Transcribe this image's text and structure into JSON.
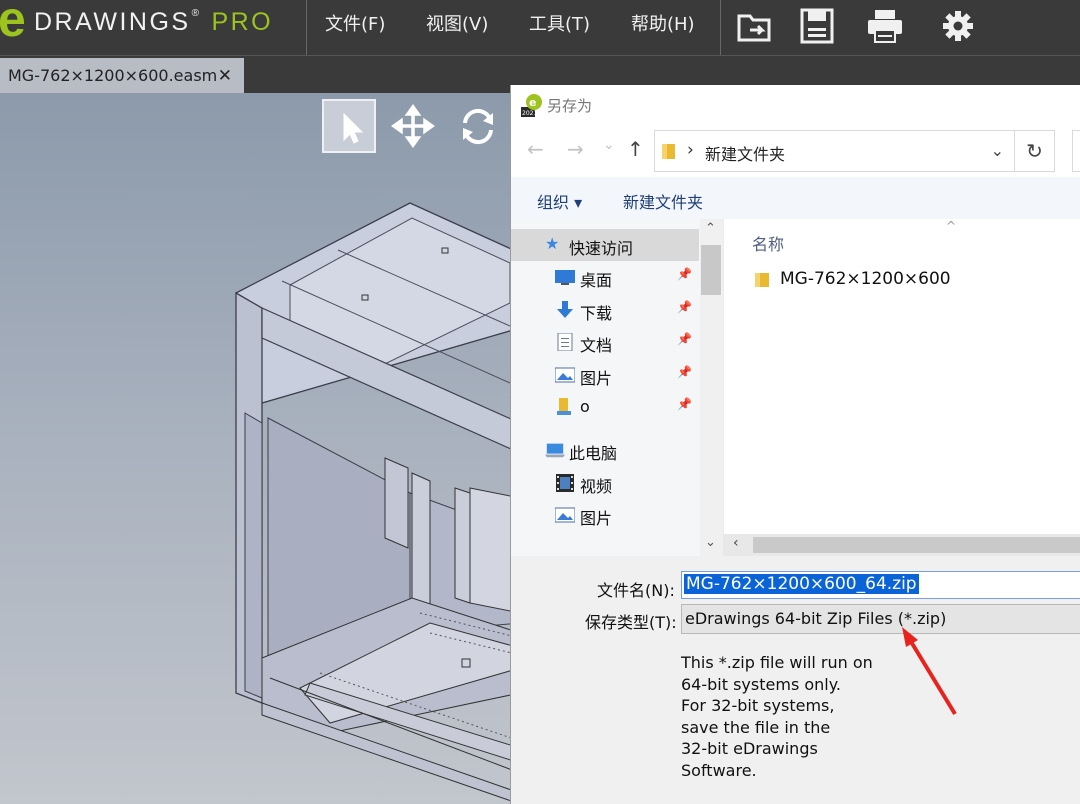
{
  "app": {
    "logo_e": "e",
    "logo_name": "DRAWINGS",
    "logo_reg": "®",
    "logo_pro": "PRO",
    "brand_color": "#9cc31e",
    "menu": [
      {
        "label": "文件(F)"
      },
      {
        "label": "视图(V)"
      },
      {
        "label": "工具(T)"
      },
      {
        "label": "帮助(H)"
      }
    ],
    "toolbar_icons": [
      "open-icon",
      "save-icon",
      "print-icon",
      "settings-gear-icon"
    ]
  },
  "document_tab": {
    "title": "MG-762×1200×600.easm",
    "close": "✕"
  },
  "viewport_tools": [
    "select-pointer-icon",
    "pan-move-icon",
    "rotate-icon"
  ],
  "dialog": {
    "title": "另存为",
    "address": {
      "back": "←",
      "forward": "→",
      "dropdown": "⌄",
      "up": "↑",
      "separator": "›",
      "current_folder": "新建文件夹",
      "chevron": "⌄",
      "refresh": "↻"
    },
    "commands": {
      "organize": "组织 ▾",
      "new_folder": "新建文件夹"
    },
    "nav_items": [
      {
        "label": "快速访问",
        "icon": "star-icon",
        "pinned": false,
        "selected": true
      },
      {
        "label": "桌面",
        "icon": "desktop-icon",
        "pinned": true
      },
      {
        "label": "下载",
        "icon": "download-icon",
        "pinned": true
      },
      {
        "label": "文档",
        "icon": "document-icon",
        "pinned": true
      },
      {
        "label": "图片",
        "icon": "pictures-icon",
        "pinned": true
      },
      {
        "label": "o",
        "icon": "user-folder-icon",
        "pinned": true
      },
      {
        "label": "此电脑",
        "icon": "computer-icon",
        "pinned": false
      },
      {
        "label": "视频",
        "icon": "video-icon",
        "pinned": false
      },
      {
        "label": "图片",
        "icon": "pictures-icon",
        "pinned": false
      }
    ],
    "file_list": {
      "column_name": "名称",
      "items": [
        {
          "name": "MG-762×1200×600",
          "type": "folder"
        }
      ]
    },
    "filename_label": "文件名(N):",
    "filename_value": "MG-762×1200×600_64.zip",
    "filetype_label": "保存类型(T):",
    "filetype_value": "eDrawings 64-bit Zip Files (*.zip)",
    "note": "This *.zip file will run on\n64-bit systems only.\nFor 32-bit systems,\nsave the file in the\n32-bit eDrawings\nSoftware."
  },
  "colors": {
    "annotation_arrow": "#e8231d",
    "selection": "#0a64d8"
  }
}
